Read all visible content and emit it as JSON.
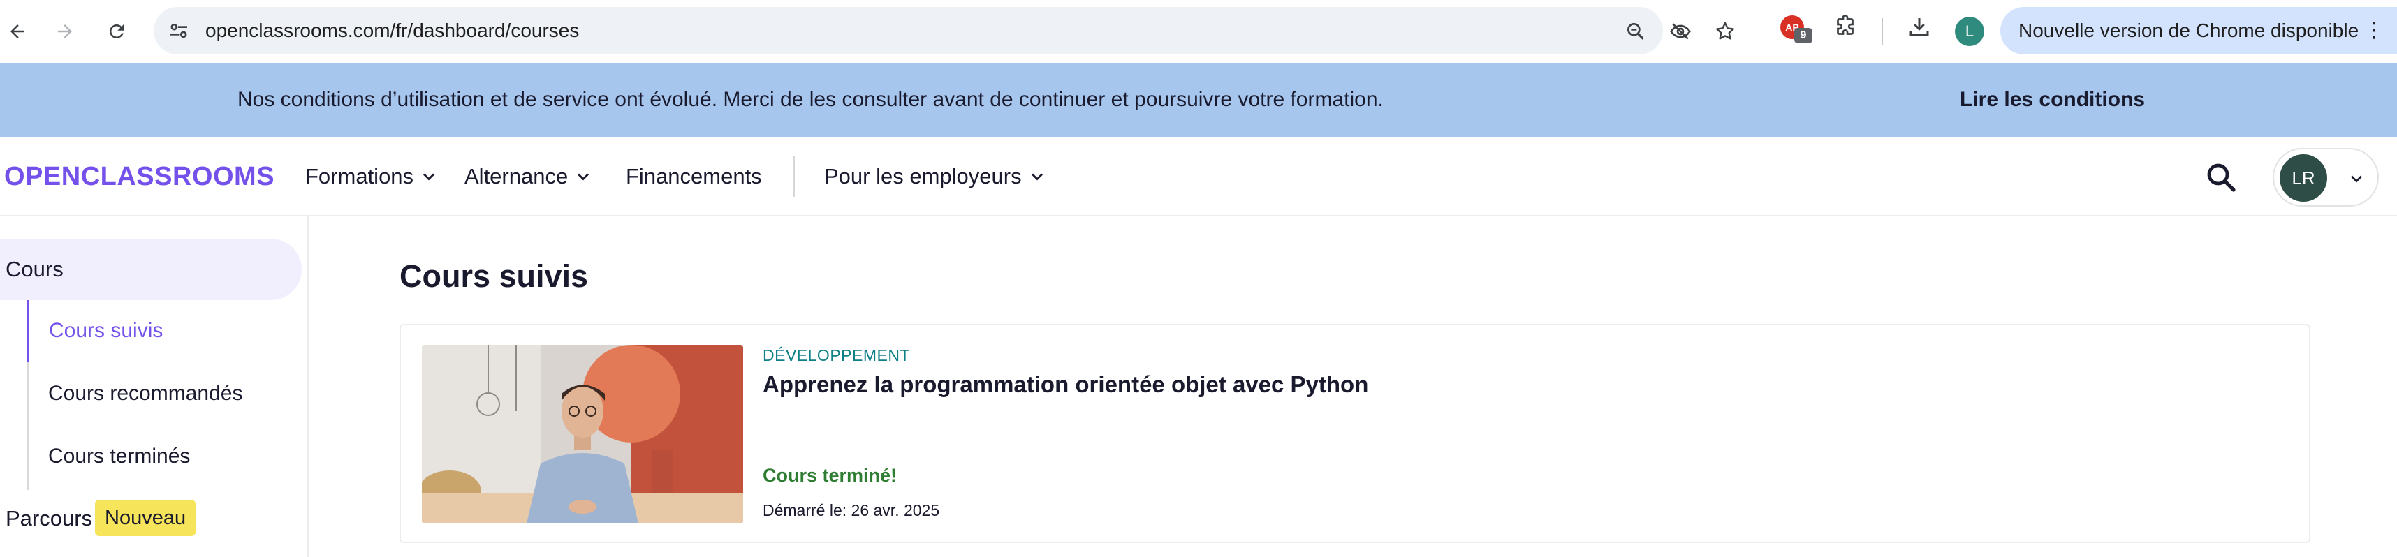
{
  "browser": {
    "url": "openclassrooms.com/fr/dashboard/courses",
    "profile_initial": "L",
    "extension_badge_label": "AP",
    "extension_badge_count": "9",
    "update_label": "Nouvelle version de Chrome disponible",
    "menu_glyph": "⋮",
    "icons": [
      "back-icon",
      "forward-icon",
      "reload-icon",
      "site-settings-icon",
      "zoom-icon",
      "eye-off-icon",
      "star-icon",
      "puzzle-icon",
      "download-icon"
    ]
  },
  "banner": {
    "message": "Nos conditions d’utilisation et de service ont évolué. Merci de les consulter avant de continuer et poursuivre votre formation.",
    "cta": "Lire les conditions"
  },
  "header": {
    "logo": "OPENCLASSROOMS",
    "menu": {
      "formations": "Formations",
      "alternance": "Alternance",
      "financements": "Financements",
      "employeurs": "Pour les employeurs"
    },
    "avatar_initials": "LR"
  },
  "sidebar": {
    "section": "Cours",
    "items": [
      "Cours suivis",
      "Cours recommandés",
      "Cours terminés"
    ],
    "parcours": "Parcours",
    "new_badge": "Nouveau"
  },
  "main": {
    "title": "Cours suivis",
    "course": {
      "category": "DÉVELOPPEMENT",
      "title": "Apprenez la programmation orientée objet avec Python",
      "status": "Cours terminé!",
      "started": "Démarré le: 26 avr. 2025"
    }
  },
  "colors": {
    "brand": "#7451eb",
    "banner": "#a6c6ed",
    "success": "#2e7d32",
    "category": "#0d7f86"
  }
}
